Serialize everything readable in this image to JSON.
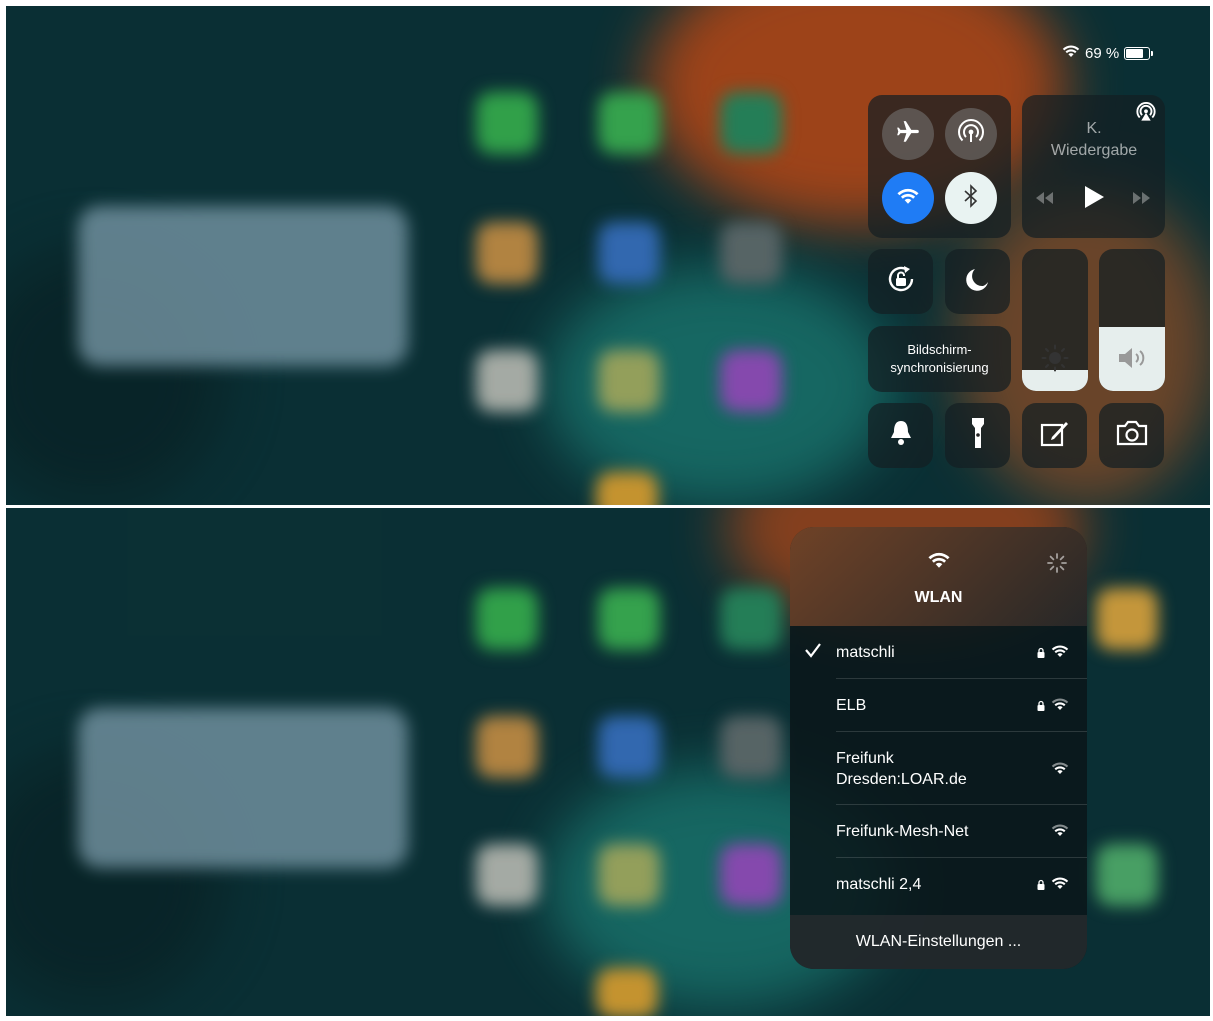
{
  "status_bar": {
    "wifi_icon": "wifi-icon",
    "battery_text": "69 %",
    "battery_level": 0.69
  },
  "control_center": {
    "connectivity": {
      "airplane_icon": "airplane-icon",
      "airdrop_icon": "airdrop-icon",
      "wifi_icon": "wifi-icon",
      "bluetooth_icon": "bluetooth-icon"
    },
    "media": {
      "title_line1": "K.",
      "title_line2": "Wiedergabe",
      "airplay_icon": "airplay-icon",
      "prev_icon": "rewind-icon",
      "play_icon": "play-icon",
      "next_icon": "fast-forward-icon"
    },
    "orientation_lock_icon": "rotation-lock-icon",
    "do_not_disturb_icon": "moon-icon",
    "screen_mirroring": {
      "line1": "Bildschirm-",
      "line2": "synchronisierung"
    },
    "brightness_level": 0.15,
    "volume_level": 0.45,
    "bottom_row": [
      "bell-icon",
      "flashlight-icon",
      "notes-icon",
      "camera-icon"
    ]
  },
  "wlan": {
    "title": "WLAN",
    "networks": [
      {
        "name": "matschli",
        "connected": true,
        "locked": true
      },
      {
        "name": "ELB",
        "connected": false,
        "locked": true
      },
      {
        "name_line1": "Freifunk",
        "name_line2": "Dresden:LOAR.de",
        "connected": false,
        "locked": false
      },
      {
        "name": "Freifunk-Mesh-Net",
        "connected": false,
        "locked": false
      },
      {
        "name": "matschli 2,4",
        "connected": false,
        "locked": true
      }
    ],
    "settings_label": "WLAN-Einstellungen ..."
  },
  "colors": {
    "accent_blue": "#1f7cf5",
    "wallpaper_orange": "#e0551f",
    "wallpaper_teal": "#0d3a40"
  }
}
